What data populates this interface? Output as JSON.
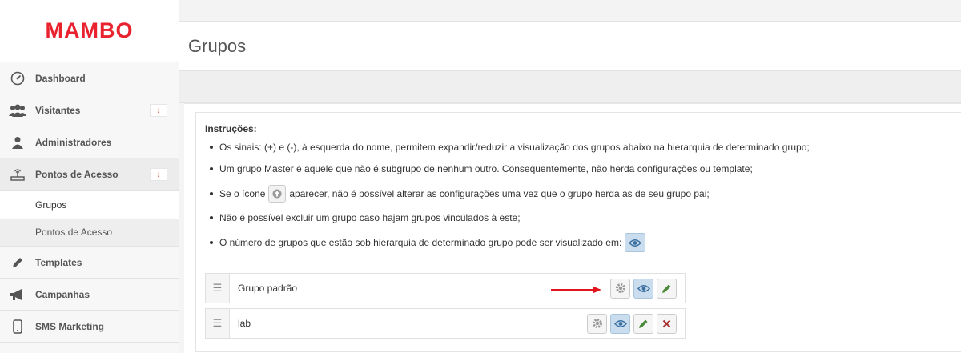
{
  "brand": {
    "logo": "MAMBO",
    "color": "#e8232f"
  },
  "sidebar": {
    "items": [
      {
        "label": "Dashboard",
        "icon": "dashboard-icon"
      },
      {
        "label": "Visitantes",
        "icon": "users-icon",
        "arrow": "↓"
      },
      {
        "label": "Administradores",
        "icon": "user-icon"
      },
      {
        "label": "Pontos de Acesso",
        "icon": "router-icon",
        "arrow": "↓"
      },
      {
        "label": "Templates",
        "icon": "pencil-icon"
      },
      {
        "label": "Campanhas",
        "icon": "megaphone-icon"
      },
      {
        "label": "SMS Marketing",
        "icon": "phone-icon"
      }
    ],
    "subitems": [
      {
        "label": "Grupos"
      },
      {
        "label": "Pontos de Acesso"
      }
    ]
  },
  "header": {
    "title": "Grupos"
  },
  "instructions": {
    "title": "Instruções:",
    "items": [
      "Os sinais: (+) e (-), à esquerda do nome, permitem expandir/reduzir a visualização dos grupos abaixo na hierarquia de determinado grupo;",
      "Um grupo Master é aquele que não é subgrupo de nenhum outro. Consequentemente, não herda configurações ou template;",
      {
        "before": "Se o ícone",
        "after": "aparecer, não é possível alterar as configurações uma vez que o grupo herda as de seu grupo pai;"
      },
      "Não é possível excluir um grupo caso hajam grupos vinculados à este;",
      {
        "before": "O número de grupos que estão sob hierarquia de determinado grupo pode ser visualizado em:"
      }
    ]
  },
  "groups": [
    {
      "name": "Grupo padrão"
    },
    {
      "name": "lab"
    }
  ],
  "colors": {
    "accent_red": "#e8232f",
    "eye_bg": "#c9ddef",
    "edit_green": "#4a8a3a",
    "delete_red": "#a33"
  }
}
